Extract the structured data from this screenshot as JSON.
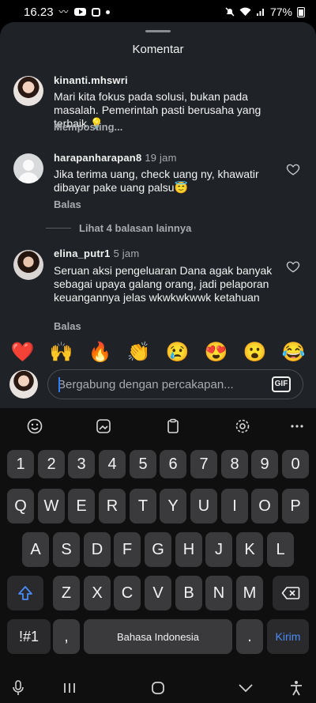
{
  "status": {
    "time": "16.23",
    "battery": "77%"
  },
  "sheet": {
    "title": "Komentar"
  },
  "comments": [
    {
      "user": "kinanti.mhswri",
      "time": "",
      "text": "Mari kita fokus pada solusi, bukan pada masalah. Pemerintah pasti berusaha yang terbaik.💡",
      "action": "Memposting..."
    },
    {
      "user": "harapanharapan8",
      "time": "19 jam",
      "text": "Jika terima uang, check uang ny, khawatir dibayar pake uang palsu😇",
      "action": "Balas"
    },
    {
      "user": "elina_putr1",
      "time": "5 jam",
      "text": "Seruan aksi pengeluaran Dana agak banyak sebagai upaya galang orang, jadi pelaporan keuangannya jelas wkwkwkwwk ketahuan",
      "action": "Balas"
    }
  ],
  "more_replies": "Lihat 4 balasan lainnya",
  "emojis": [
    "❤️",
    "🙌",
    "🔥",
    "👏",
    "😢",
    "😍",
    "😮",
    "😂"
  ],
  "input": {
    "placeholder": "Bergabung dengan percakapan...",
    "gif_label": "GIF"
  },
  "keyboard": {
    "numbers": [
      "1",
      "2",
      "3",
      "4",
      "5",
      "6",
      "7",
      "8",
      "9",
      "0"
    ],
    "row1": [
      "Q",
      "W",
      "E",
      "R",
      "T",
      "Y",
      "U",
      "I",
      "O",
      "P"
    ],
    "row2": [
      "A",
      "S",
      "D",
      "F",
      "G",
      "H",
      "J",
      "K",
      "L"
    ],
    "row3": [
      "Z",
      "X",
      "C",
      "V",
      "B",
      "N",
      "M"
    ],
    "symbols": "!#1",
    "comma": ",",
    "space": "Bahasa Indonesia",
    "period": ".",
    "enter": "Kirim"
  },
  "icons": {
    "shift": "shift-icon",
    "backspace": "backspace-icon",
    "emoji": "emoji-icon",
    "sticker": "sticker-icon",
    "clipboard": "clipboard-icon",
    "settings": "settings-icon",
    "more": "more-icon"
  }
}
